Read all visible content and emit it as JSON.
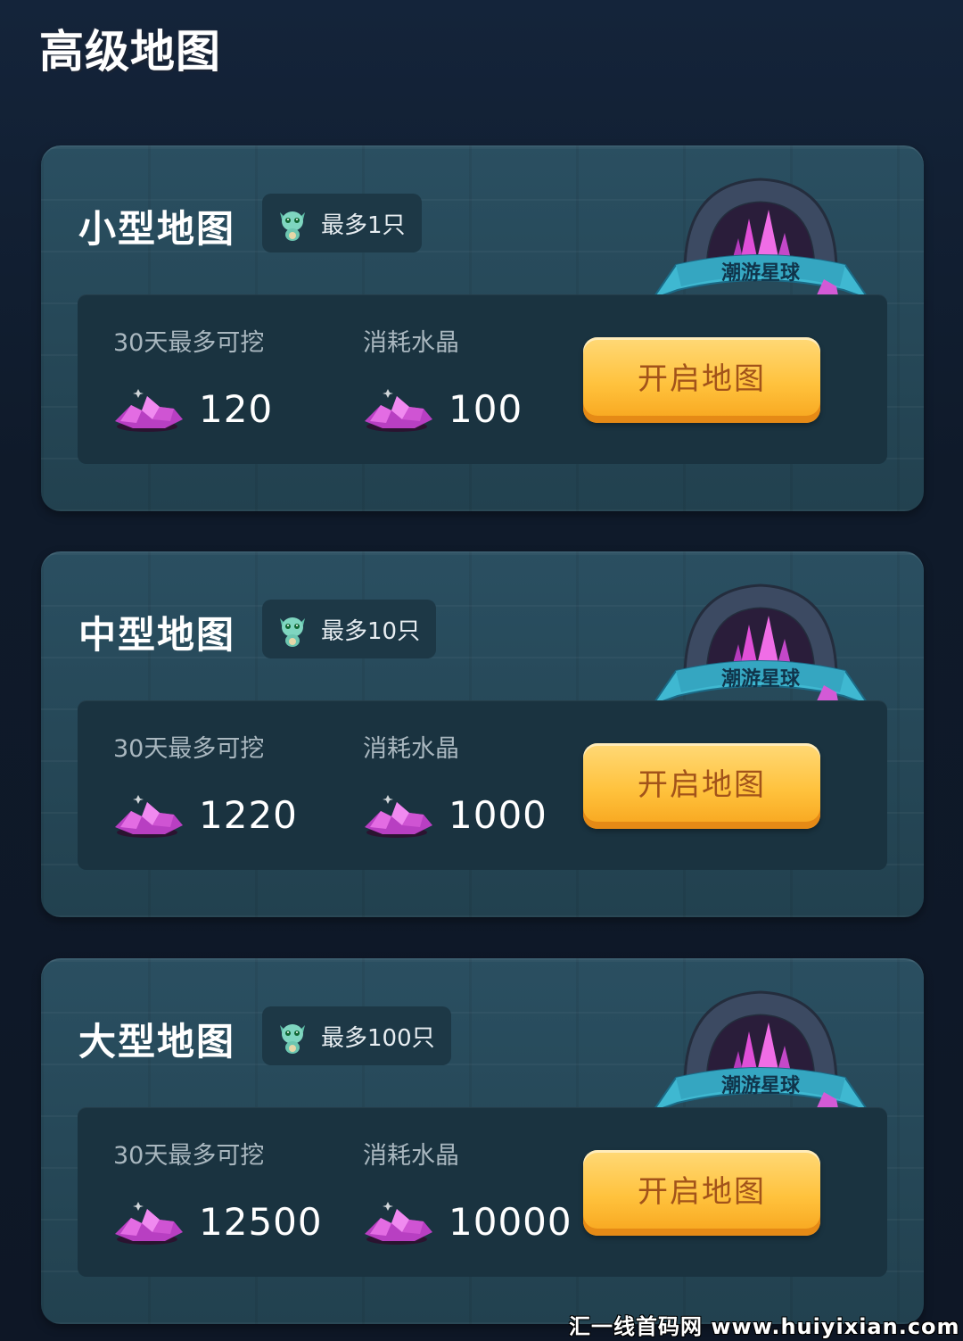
{
  "page": {
    "title": "高级地图"
  },
  "emblem_text": "潮游星球",
  "cards": [
    {
      "title": "小型地图",
      "limit": "最多1只",
      "mine_label": "30天最多可挖",
      "mine_value": "120",
      "cost_label": "消耗水晶",
      "cost_value": "100",
      "button": "开启地图"
    },
    {
      "title": "中型地图",
      "limit": "最多10只",
      "mine_label": "30天最多可挖",
      "mine_value": "1220",
      "cost_label": "消耗水晶",
      "cost_value": "1000",
      "button": "开启地图"
    },
    {
      "title": "大型地图",
      "limit": "最多100只",
      "mine_label": "30天最多可挖",
      "mine_value": "12500",
      "cost_label": "消耗水晶",
      "cost_value": "10000",
      "button": "开启地图"
    }
  ],
  "watermark": "汇一线首码网 www.huiyixian.com",
  "colors": {
    "background": "#0f1a2a",
    "card": "#244657",
    "panel": "#1a3340",
    "button": "#ffc23d",
    "button_text": "#a2531a",
    "crystal": "#d14bd6"
  },
  "icons": [
    "pet-icon",
    "crystal-icon",
    "emblem-logo"
  ]
}
